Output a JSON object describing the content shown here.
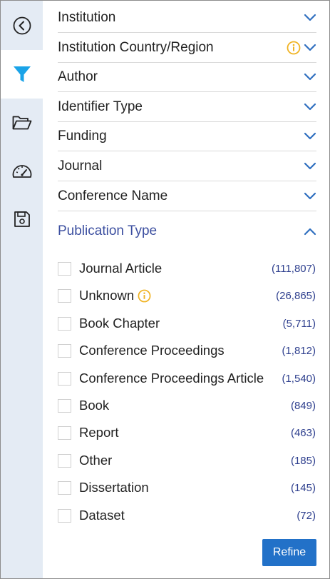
{
  "rail": {
    "items": [
      {
        "icon": "back-circle-icon"
      },
      {
        "icon": "filter-icon",
        "active": true
      },
      {
        "icon": "folder-open-icon"
      },
      {
        "icon": "dashboard-gauge-icon"
      },
      {
        "icon": "save-disk-icon"
      }
    ]
  },
  "filters": [
    {
      "label": "Institution",
      "info": false
    },
    {
      "label": "Institution Country/Region",
      "info": true
    },
    {
      "label": "Author",
      "info": false
    },
    {
      "label": "Identifier Type",
      "info": false
    },
    {
      "label": "Funding",
      "info": false
    },
    {
      "label": "Journal",
      "info": false
    },
    {
      "label": "Conference Name",
      "info": false
    }
  ],
  "publication_type": {
    "title": "Publication Type",
    "expanded": true,
    "options": [
      {
        "label": "Journal Article",
        "count": "(111,807)",
        "info": false
      },
      {
        "label": "Unknown",
        "count": "(26,865)",
        "info": true
      },
      {
        "label": "Book Chapter",
        "count": "(5,711)",
        "info": false
      },
      {
        "label": "Conference Proceedings",
        "count": "(1,812)",
        "info": false
      },
      {
        "label": "Conference Proceedings Article",
        "count": "(1,540)",
        "info": false
      },
      {
        "label": "Book",
        "count": "(849)",
        "info": false
      },
      {
        "label": "Report",
        "count": "(463)",
        "info": false
      },
      {
        "label": "Other",
        "count": "(185)",
        "info": false
      },
      {
        "label": "Dissertation",
        "count": "(145)",
        "info": false
      },
      {
        "label": "Dataset",
        "count": "(72)",
        "info": false
      }
    ]
  },
  "refine_button": "Refine",
  "colors": {
    "rail_bg": "#e4ebf4",
    "accent_blue": "#2f6fbf",
    "filter_icon": "#1aa3e8",
    "title_blue": "#3c4fa0",
    "count_blue": "#2e3f8e",
    "info_yellow": "#f0b323",
    "button_blue": "#2271c8"
  }
}
